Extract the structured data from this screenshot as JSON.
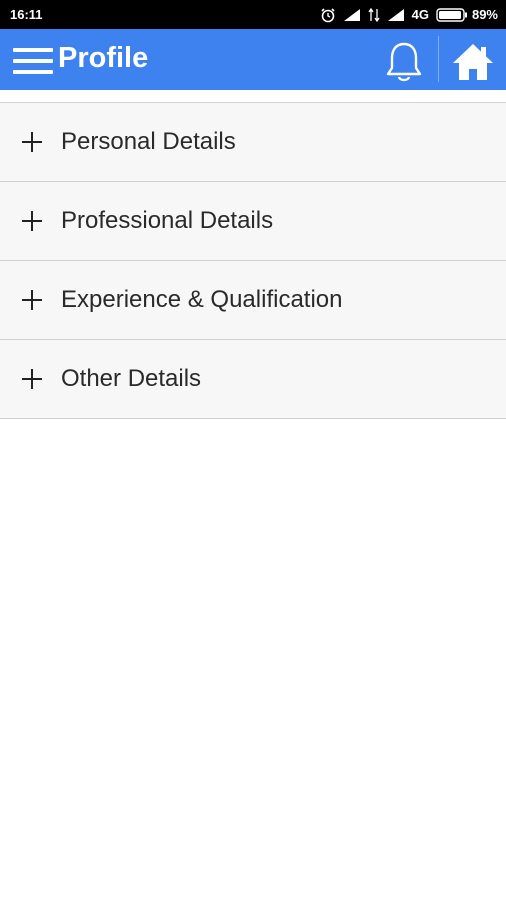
{
  "status_bar": {
    "time": "16:11",
    "network": "4G",
    "battery": "89%",
    "icons": [
      "alarm-icon",
      "signal-icon",
      "data-arrows-icon",
      "signal-icon",
      "battery-icon"
    ]
  },
  "app_bar": {
    "title": "Profile",
    "color": "#3d82ee",
    "icons": [
      "menu-icon",
      "bell-icon",
      "home-icon"
    ]
  },
  "accordion": {
    "items": [
      {
        "label": "Personal Details",
        "icon": "plus-icon"
      },
      {
        "label": "Professional Details",
        "icon": "plus-icon"
      },
      {
        "label": "Experience & Qualification",
        "icon": "plus-icon"
      },
      {
        "label": "Other Details",
        "icon": "plus-icon"
      }
    ]
  }
}
